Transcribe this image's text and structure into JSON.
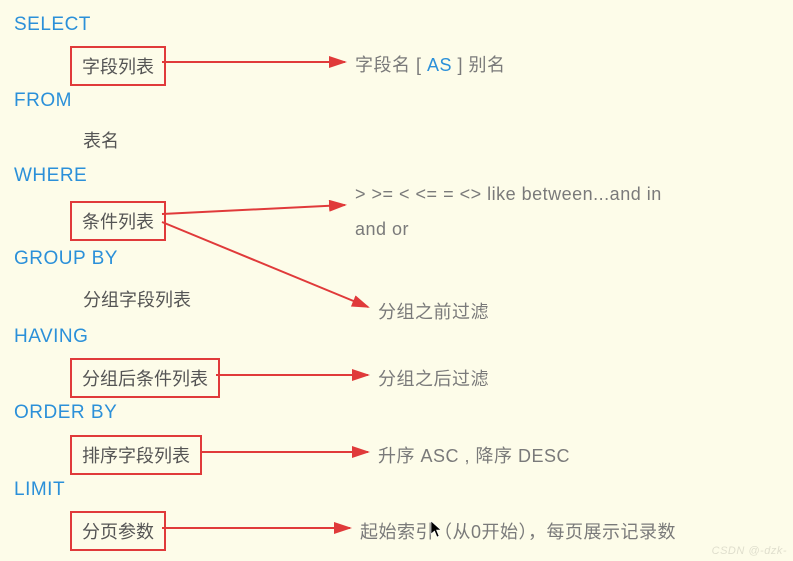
{
  "clauses": {
    "select": {
      "keyword": "SELECT",
      "box": "字段列表",
      "desc_prefix": "字段名 [",
      "desc_as": " AS ",
      "desc_suffix": "] 别名"
    },
    "from": {
      "keyword": "FROM",
      "sub": "表名"
    },
    "where": {
      "keyword": "WHERE",
      "box": "条件列表",
      "desc1": "> >= < <= = <> like between...and in",
      "desc2": "and or",
      "desc3": "分组之前过滤"
    },
    "groupby": {
      "keyword": "GROUP BY",
      "sub": "分组字段列表"
    },
    "having": {
      "keyword": "HAVING",
      "box": "分组后条件列表",
      "desc": "分组之后过滤"
    },
    "orderby": {
      "keyword": "ORDER BY",
      "box": "排序字段列表",
      "desc": "升序 ASC , 降序 DESC"
    },
    "limit": {
      "keyword": "LIMIT",
      "box": "分页参数",
      "desc": "起始索引（从0开始），每页展示记录数"
    }
  },
  "watermark": "CSDN @-dzk-"
}
